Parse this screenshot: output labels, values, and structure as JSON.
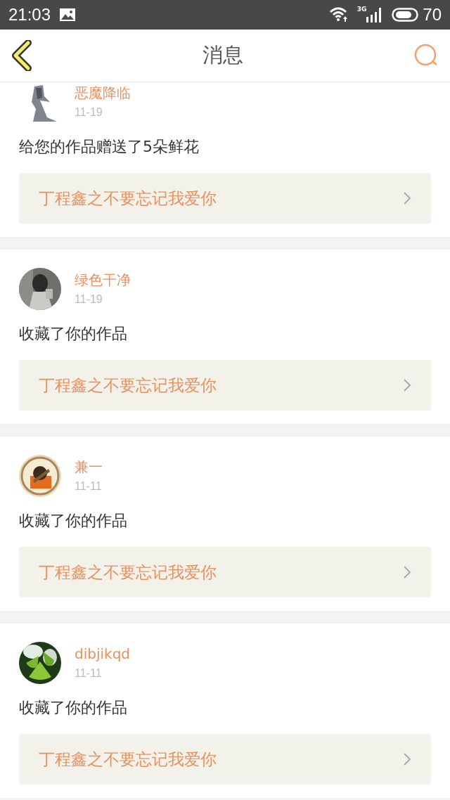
{
  "status_bar": {
    "time": "21:03",
    "network": "3G",
    "battery": "70"
  },
  "header": {
    "title": "消息"
  },
  "messages": [
    {
      "name": "恶魔降临",
      "date": "11-19",
      "action": "给您的作品赠送了5朵鲜花",
      "work_title": "丁程鑫之不要忘记我爱你"
    },
    {
      "name": "绿色干净",
      "date": "11-19",
      "action": "收藏了你的作品",
      "work_title": "丁程鑫之不要忘记我爱你"
    },
    {
      "name": "兼一",
      "date": "11-11",
      "action": "收藏了你的作品",
      "work_title": "丁程鑫之不要忘记我爱你"
    },
    {
      "name": "dibjikqd",
      "date": "11-11",
      "action": "收藏了你的作品",
      "work_title": "丁程鑫之不要忘记我爱你"
    }
  ]
}
